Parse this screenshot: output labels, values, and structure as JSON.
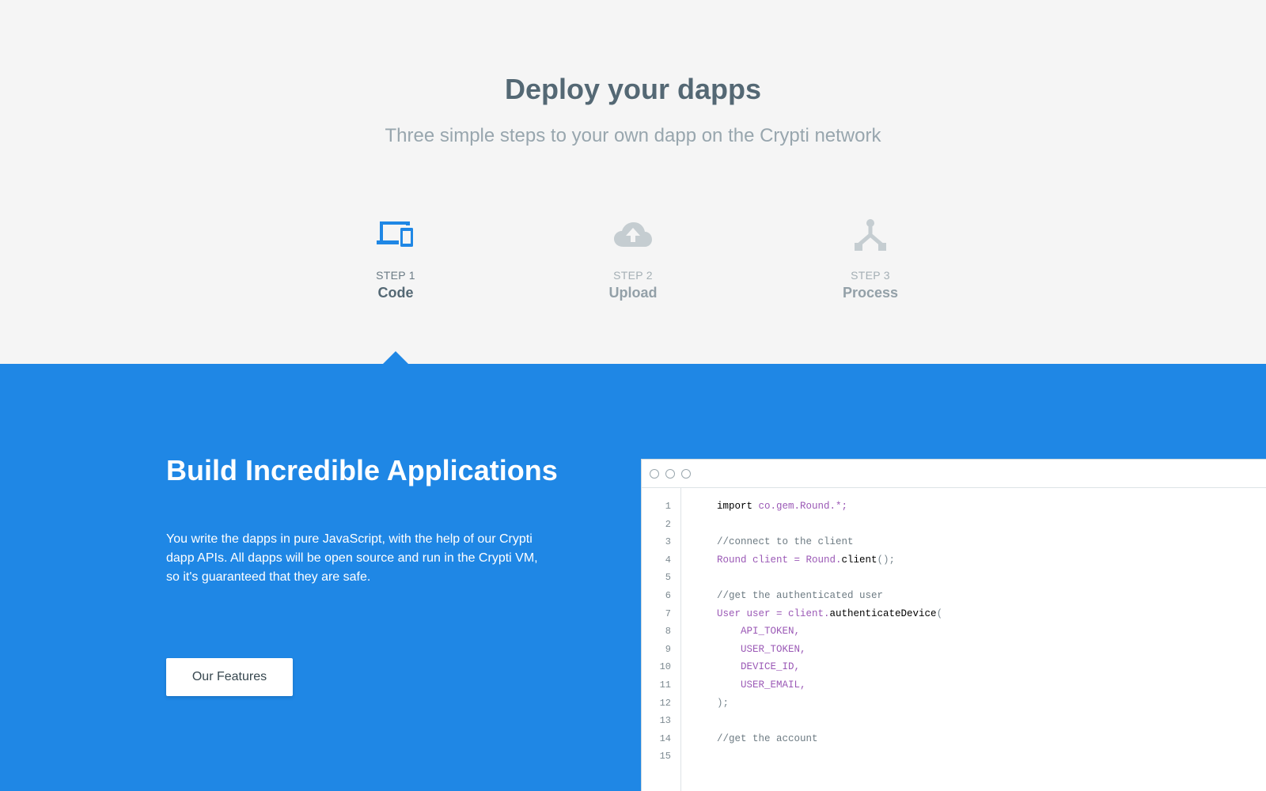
{
  "header": {
    "title": "Deploy your dapps",
    "subtitle": "Three simple steps to your own dapp on the Crypti network"
  },
  "steps": [
    {
      "number": "STEP 1",
      "label": "Code",
      "icon": "devices-icon",
      "active": true
    },
    {
      "number": "STEP 2",
      "label": "Upload",
      "icon": "cloud-upload-icon",
      "active": false
    },
    {
      "number": "STEP 3",
      "label": "Process",
      "icon": "fork-icon",
      "active": false
    }
  ],
  "build": {
    "title": "Build Incredible Applications",
    "text": "You write the dapps in pure JavaScript, with the help of our Crypti dapp APIs. All dapps will be open source and run in the Crypti VM, so it's guaranteed that they are safe.",
    "button_label": "Our Features"
  },
  "colors": {
    "accent": "#1f87e5",
    "title": "#546874",
    "subtitle": "#98a6ae",
    "inactive_icon": "#c5cdd1"
  },
  "code": {
    "line_numbers": [
      "1",
      "2",
      "3",
      "4",
      "5",
      "6",
      "7",
      "8",
      "9",
      "10",
      "11",
      "12",
      "13",
      "14",
      "15"
    ],
    "lines": [
      [
        {
          "t": "import",
          "c": "kw"
        },
        {
          "t": " co.gem.Round.*;",
          "c": "pl"
        }
      ],
      [],
      [
        {
          "t": "//connect to the client",
          "c": "cm"
        }
      ],
      [
        {
          "t": "Round client = Round.",
          "c": "pl"
        },
        {
          "t": "client",
          "c": "fn"
        },
        {
          "t": "();",
          "c": "pn"
        }
      ],
      [],
      [
        {
          "t": "//get the authenticated user",
          "c": "cm"
        }
      ],
      [
        {
          "t": "User user = client.",
          "c": "pl"
        },
        {
          "t": "authenticateDevice",
          "c": "fn"
        },
        {
          "t": "(",
          "c": "pn"
        }
      ],
      [
        {
          "t": "    API_TOKEN,",
          "c": "pl"
        }
      ],
      [
        {
          "t": "    USER_TOKEN,",
          "c": "pl"
        }
      ],
      [
        {
          "t": "    DEVICE_ID,",
          "c": "pl"
        }
      ],
      [
        {
          "t": "    USER_EMAIL,",
          "c": "pl"
        }
      ],
      [
        {
          "t": ");",
          "c": "pn"
        }
      ],
      [],
      [
        {
          "t": "//get the account",
          "c": "cm"
        }
      ],
      []
    ]
  }
}
